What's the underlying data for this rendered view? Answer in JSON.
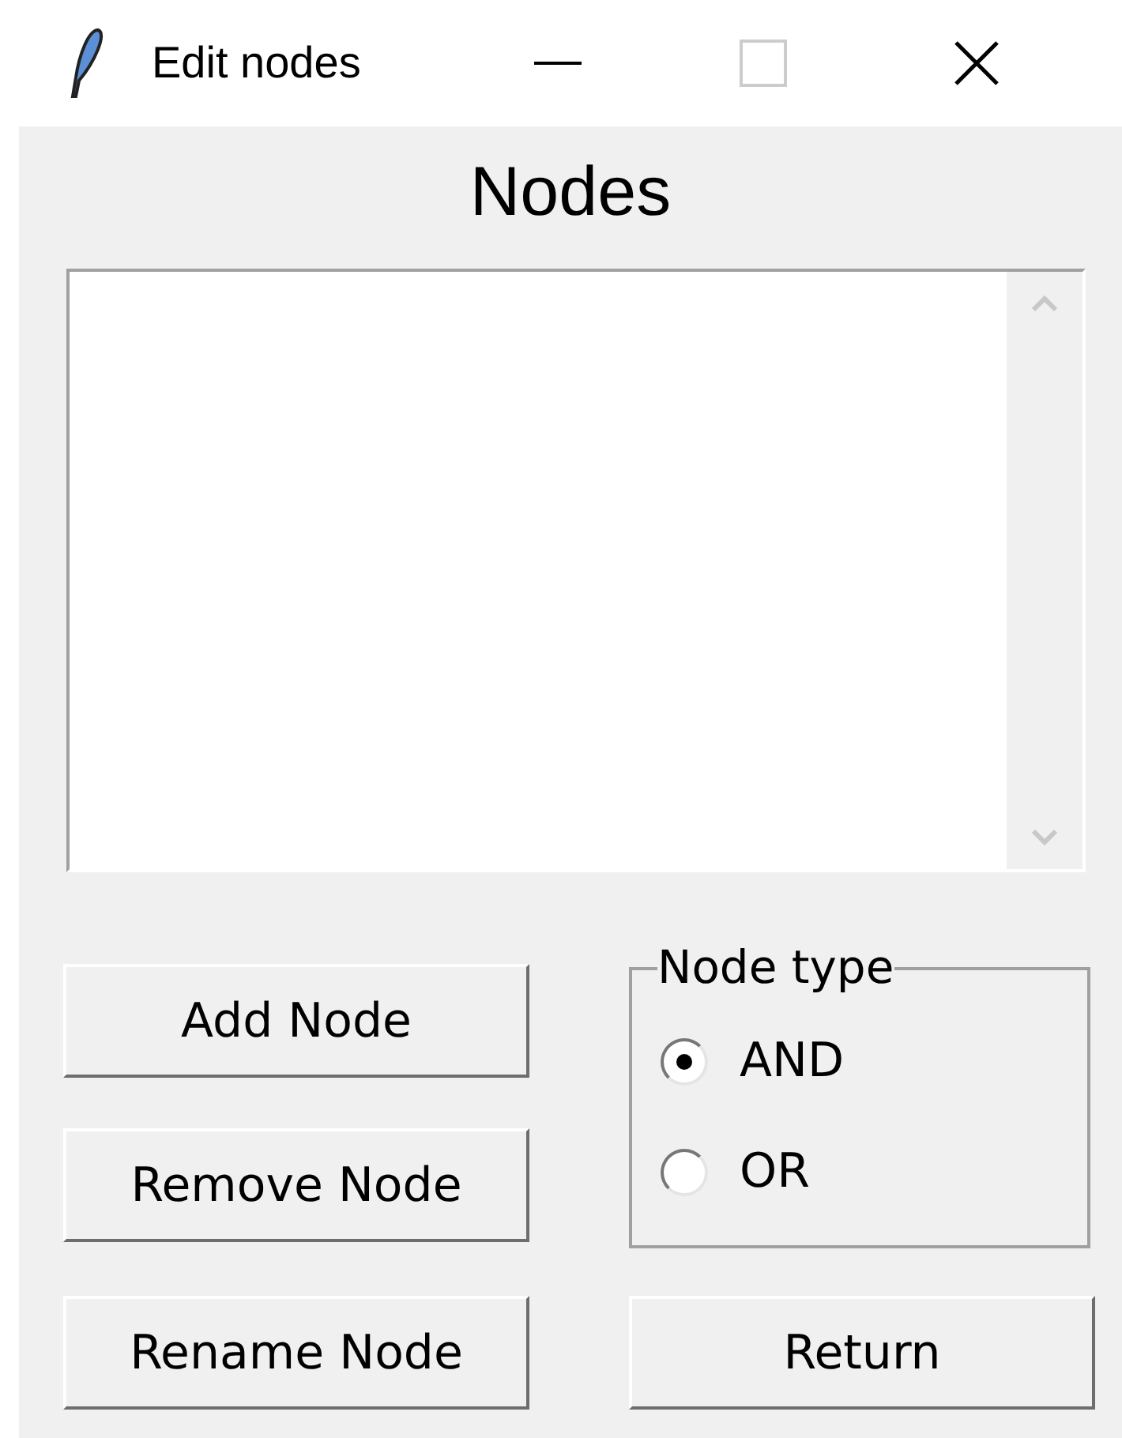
{
  "window": {
    "title": "Edit nodes"
  },
  "heading": "Nodes",
  "buttons": [
    "Add Node",
    "Remove Node",
    "Rename Node"
  ],
  "node_type": {
    "label": "Node type",
    "options": [
      {
        "label": "AND",
        "selected": true
      },
      {
        "label": "OR",
        "selected": false
      }
    ]
  },
  "return_button": "Return"
}
